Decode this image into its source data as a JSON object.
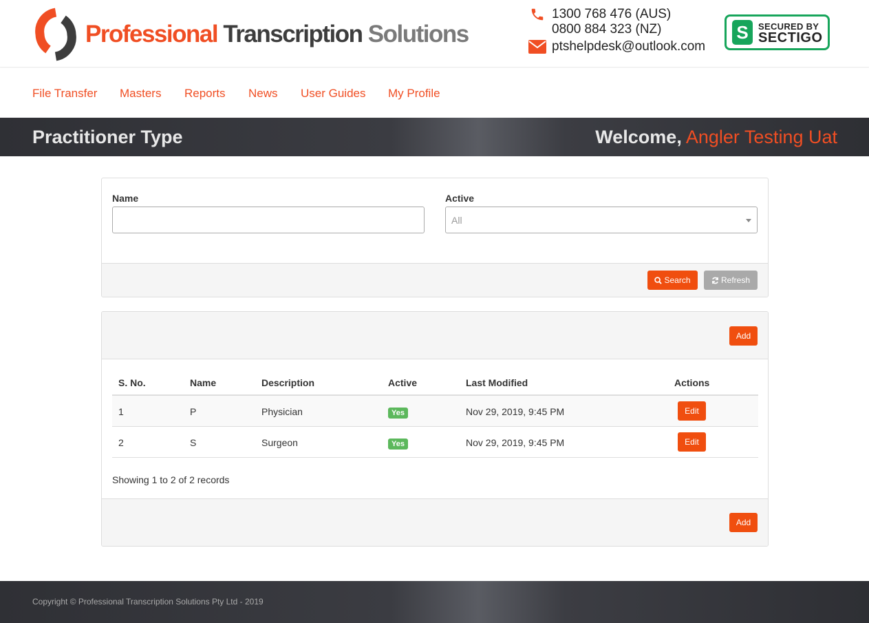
{
  "brand": {
    "part1": "Professional",
    "part2": "Transcription",
    "part3": "Solutions",
    "accent_color": "#f04e23",
    "dark_color": "#3d3d3d"
  },
  "contact": {
    "phone_aus": "1300 768 476 (AUS)",
    "phone_nz": "0800 884 323 (NZ)",
    "email": "ptshelpdesk@outlook.com"
  },
  "secured_badge": {
    "line1": "SECURED BY",
    "line2": "SECTIGO",
    "icon_letter": "S",
    "color": "#17a55b"
  },
  "nav": {
    "items": [
      {
        "label": "File Transfer"
      },
      {
        "label": "Masters"
      },
      {
        "label": "Reports"
      },
      {
        "label": "News"
      },
      {
        "label": "User Guides"
      },
      {
        "label": "My Profile"
      }
    ]
  },
  "banner": {
    "title": "Practitioner Type",
    "welcome_label": "Welcome,",
    "user_name": "Angler Testing Uat"
  },
  "filter": {
    "name_label": "Name",
    "name_value": "",
    "active_label": "Active",
    "active_value": "All",
    "search_label": "Search",
    "refresh_label": "Refresh"
  },
  "list": {
    "add_label": "Add",
    "columns": [
      "S. No.",
      "Name",
      "Description",
      "Active",
      "Last Modified",
      "Actions"
    ],
    "rows": [
      {
        "sno": "1",
        "name": "P",
        "description": "Physician",
        "active": "Yes",
        "last_modified": "Nov 29, 2019, 9:45 PM",
        "action": "Edit"
      },
      {
        "sno": "2",
        "name": "S",
        "description": "Surgeon",
        "active": "Yes",
        "last_modified": "Nov 29, 2019, 9:45 PM",
        "action": "Edit"
      }
    ],
    "records_text": "Showing 1 to 2 of 2 records"
  },
  "footer": {
    "copyright": "Copyright © Professional Transcription Solutions Pty Ltd - 2019"
  },
  "icons": {
    "phone": "phone-icon",
    "email": "envelope-icon",
    "search": "search-icon",
    "refresh": "refresh-icon"
  }
}
